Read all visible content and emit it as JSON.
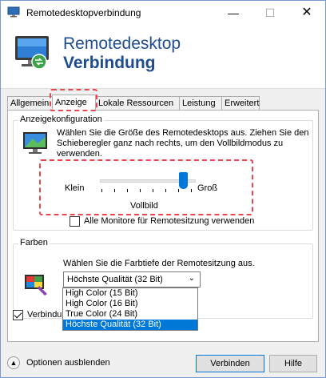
{
  "window": {
    "title": "Remotedesktopverbindung",
    "controls": {
      "minimize": "—",
      "maximize": "☐",
      "close": "✕"
    }
  },
  "header": {
    "line1": "Remotedesktop",
    "line2": "Verbindung"
  },
  "tabs": [
    {
      "label": "Allgemein"
    },
    {
      "label": "Anzeige"
    },
    {
      "label": "Lokale Ressourcen"
    },
    {
      "label": "Leistung"
    },
    {
      "label": "Erweitert"
    }
  ],
  "display_config": {
    "group_label": "Anzeigekonfiguration",
    "description": "Wählen Sie die Größe des Remotedesktops aus. Ziehen Sie den Schieberegler ganz nach rechts, um den Vollbildmodus zu verwenden.",
    "slider": {
      "min_label": "Klein",
      "max_label": "Groß",
      "value_label": "Vollbild",
      "position": 1.0
    },
    "all_monitors_label": "Alle Monitore für Remotesitzung verwenden",
    "all_monitors_checked": false
  },
  "colors": {
    "group_label": "Farben",
    "description": "Wählen Sie die Farbtiefe der Remotesitzung aus.",
    "selected": "Höchste Qualität (32 Bit)",
    "options": [
      "High Color (15 Bit)",
      "High Color (16 Bit)",
      "True Color (24 Bit)",
      "Höchste Qualität (32 Bit)"
    ]
  },
  "connection_bar": {
    "label": "Verbindun",
    "checked": true
  },
  "footer": {
    "options_toggle": "Optionen ausblenden",
    "connect_button": "Verbinden",
    "help_button": "Hilfe"
  },
  "theme": {
    "accent": "#0078d7",
    "highlight": "#e8474f",
    "brand": "#1f4b8f"
  }
}
